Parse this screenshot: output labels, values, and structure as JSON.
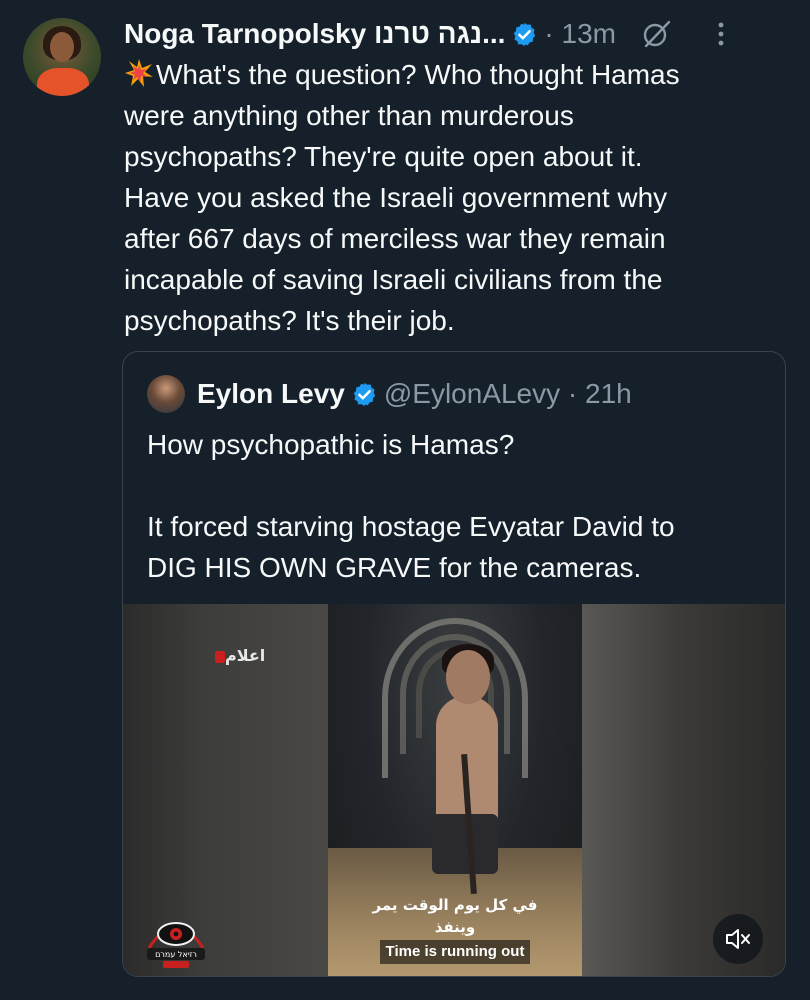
{
  "tweet": {
    "author_name": "Noga Tarnopolsky נגה טרנו...",
    "meta": "· 13m",
    "text_lines": [
      "What's the question? Who thought Hamas",
      "were anything other than murderous",
      "psychopaths? They're quite open about it.",
      "Have you asked the Israeli government why",
      "after 667 days of merciless war they remain",
      "incapable of saving Israeli civilians from the",
      "psychopaths? It's their job."
    ],
    "emoji": "collision-emoji"
  },
  "quoted": {
    "author_name": "Eylon Levy",
    "meta": "@EylonALevy · 21h",
    "text_lines": [
      "How psychopathic is Hamas?",
      "",
      "It forced starving hostage Evyatar David to",
      "DIG HIS OWN GRAVE for the cameras."
    ],
    "media": {
      "watermark_top": "اعلام",
      "subtitle_ar": "في كل يوم الوقت يمر وينفذ",
      "subtitle_en": "Time is running out",
      "logo_text": "רזיאל עמרם"
    }
  },
  "colors": {
    "background": "#15202b",
    "text": "#f7f9f9",
    "muted": "#8b98a5",
    "verified": "#1d9bf0",
    "border": "#38444d"
  },
  "icons": [
    "verified-badge-icon",
    "grok-icon",
    "more-options-icon",
    "mute-icon"
  ]
}
